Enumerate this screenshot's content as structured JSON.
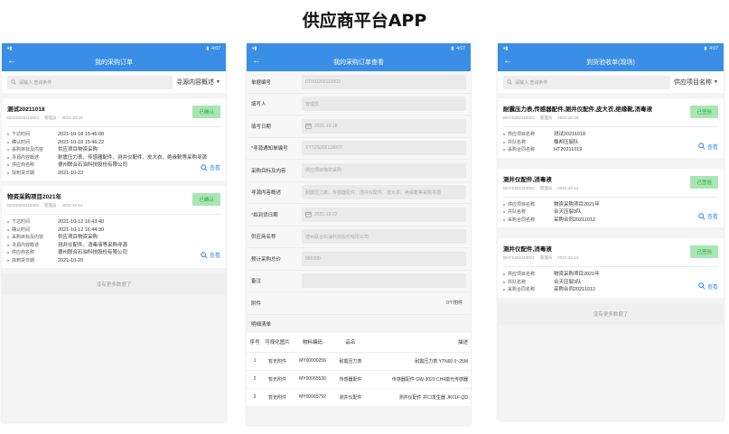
{
  "page_title": "供应商平台APP",
  "colors": {
    "primary": "#3a8ee6",
    "badge_bg": "#a8e6b2",
    "badge_text": "#2e9c48",
    "required": "#e03030"
  },
  "status_bar": {
    "time": "4:07"
  },
  "screen1": {
    "title": "我的采购订单",
    "search_placeholder": "请输入 查询条件",
    "filter_label": "寻源内容概述",
    "orders": [
      {
        "title": "测试20211018",
        "code": "DDXD202110003",
        "creator": "管理员",
        "date": "2021-10-19",
        "status": "已确认",
        "fields": [
          {
            "label": "下达时间",
            "value": "2021-10-18 15:46:08"
          },
          {
            "label": "确认时间",
            "value": "2021-10-18 15:46:22"
          },
          {
            "label": "采购目标及内容",
            "value": "供应项目物资采购"
          },
          {
            "label": "寻源内容概述",
            "value": "耐震压力表、传感器配件、测井仪配件、皮大衣、绝缘靴等采购寻源"
          },
          {
            "label": "供应商名称",
            "value": "德州联合石油科技股份有限公司"
          },
          {
            "label": "拟到货日期",
            "value": "2021-10-22"
          }
        ],
        "view_label": "查看"
      },
      {
        "title": "物资采购项目2021年",
        "code": "DDXD202110002",
        "creator": "管理员",
        "date": "2021-10-12",
        "status": "已确认",
        "fields": [
          {
            "label": "下达时间",
            "value": "2021-10-12 16:43:40"
          },
          {
            "label": "确认时间",
            "value": "2021-10-12 16:44:30"
          },
          {
            "label": "采购目标及内容",
            "value": "供应项目物资采购"
          },
          {
            "label": "寻源内容概述",
            "value": "测井仪配件、消毒液等采购寻源"
          },
          {
            "label": "供应商名称",
            "value": "德州联合石油科技股份有限公司"
          },
          {
            "label": "拟到货日期",
            "value": "2021-10-20"
          }
        ],
        "view_label": "查看"
      }
    ],
    "no_more": "没有更多数据了"
  },
  "screen2": {
    "title": "我的采购订单查看",
    "fields": [
      {
        "label": "单据编号",
        "value": "DDXD202110003",
        "required": false
      },
      {
        "label": "填写人",
        "value": "管理员",
        "required": false
      },
      {
        "label": "填写日期",
        "value": "2021-10-18",
        "required": false,
        "date": true
      },
      {
        "label": "寻源通知单编号",
        "value": "XYTZS202110007",
        "required": true
      },
      {
        "label": "采购目标及内容",
        "value": "供应项目物资采购",
        "required": false
      },
      {
        "label": "寻源内容概述",
        "value": "耐震压力表、传感器配件、测井仪配件、皮大衣、绝缘靴等采购寻源",
        "required": false
      },
      {
        "label": "拟到货日期",
        "value": "2021-10-22",
        "required": true,
        "date": true
      },
      {
        "label": "供应商名称",
        "value": "德州联合石油科技股份有限公司",
        "required": false
      },
      {
        "label": "预计采购总价",
        "value": "888200",
        "required": false
      },
      {
        "label": "备注",
        "value": "",
        "required": false
      }
    ],
    "attachment_label": "附件",
    "attachment_value": "0个附件",
    "detail_section": "明细清单",
    "table_headers": [
      "序号",
      "可视化图片",
      "物料编码",
      "品名",
      "描述"
    ],
    "table_rows": [
      [
        "1",
        "暂无附件",
        "MY00000256",
        "耐震压力表",
        "耐震压力表 YTN60 0~25M"
      ],
      [
        "2",
        "暂无附件",
        "MY00065536",
        "传感器配件",
        "传感器配件 GW-3020 CH4激光传感器"
      ],
      [
        "3",
        "暂无附件",
        "MY00065792",
        "测井仪配件",
        "测井仪配件 井口发生器 JK01F-QD"
      ]
    ]
  },
  "screen3": {
    "title": "到货验收单(现场)",
    "search_placeholder": "请输入 查询条件",
    "filter_label": "供应项目名称",
    "items": [
      {
        "title": "耐震压力表,传感器配件,测井仪配件,皮大衣,绝缘靴,消毒液",
        "code": "DHYS202110004",
        "creator": "管理员",
        "date": "2021-10-19",
        "status": "已签验",
        "fields": [
          {
            "label": "供应项目名称",
            "value": "测试20211018"
          },
          {
            "label": "井队名称",
            "value": "橡邦压裂队"
          },
          {
            "label": "采购合同名称",
            "value": "HT20211019"
          }
        ],
        "view_label": "查看"
      },
      {
        "title": "测井仪配件,消毒液",
        "code": "DHYS202110002",
        "creator": "管理员",
        "date": "2021-10-12",
        "status": "已签验",
        "fields": [
          {
            "label": "供应项目名称",
            "value": "物资采购项目2021年"
          },
          {
            "label": "井队名称",
            "value": "合天压裂3队"
          },
          {
            "label": "采购合同名称",
            "value": "采购合同20211012"
          }
        ],
        "view_label": "查看"
      },
      {
        "title": "测井仪配件,消毒液",
        "code": "DHYS202110001",
        "creator": "管理员",
        "date": "2021-10-12",
        "status": "已签验",
        "fields": [
          {
            "label": "供应项目名称",
            "value": "物资采购项目2021年"
          },
          {
            "label": "井队名称",
            "value": "合天压裂3队"
          },
          {
            "label": "采购合同名称",
            "value": "采购合同20211012"
          }
        ],
        "view_label": "查看"
      }
    ],
    "no_more": "没有更多数据了"
  }
}
